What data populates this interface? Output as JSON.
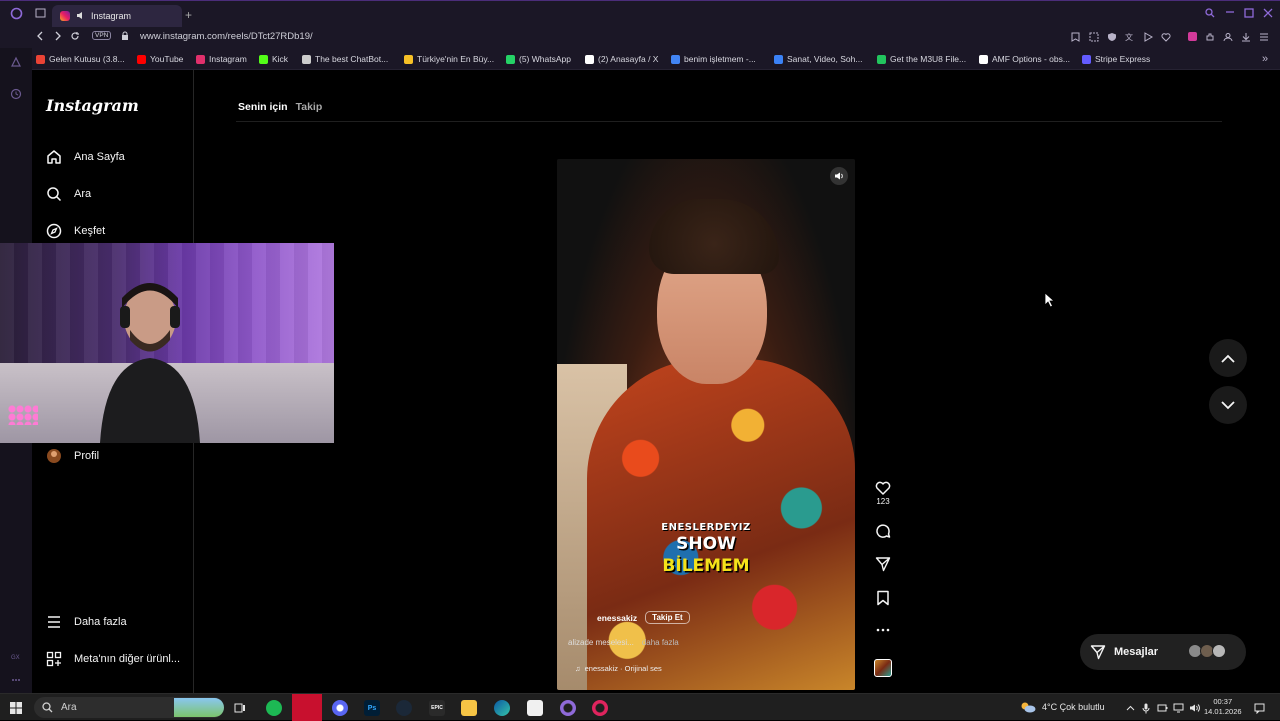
{
  "browser": {
    "tab_title": "Instagram",
    "url": "www.instagram.com/reels/DTct27RDb19/",
    "vpn_label": "VPN",
    "bookmarks": [
      {
        "label": "Gelen Kutusu (3.8...",
        "color": "#ea4335"
      },
      {
        "label": "YouTube",
        "color": "#ff0000"
      },
      {
        "label": "Instagram",
        "color": "#e1306c"
      },
      {
        "label": "Kick",
        "color": "#53fc18"
      },
      {
        "label": "The best ChatBot...",
        "color": "#cccccc"
      },
      {
        "label": "Türkiye'nin En Büy...",
        "color": "#f6c026"
      },
      {
        "label": "(5) WhatsApp",
        "color": "#25d366"
      },
      {
        "label": "(2) Anasayfa / X",
        "color": "#ffffff"
      },
      {
        "label": "benim işletmem -...",
        "color": "#4285f4"
      },
      {
        "label": "Sanat, Video, Soh...",
        "color": "#3b82f6"
      },
      {
        "label": "Get the M3U8 File...",
        "color": "#22c55e"
      },
      {
        "label": "AMF Options - obs...",
        "color": "#ffffff"
      },
      {
        "label": "Stripe Express",
        "color": "#635bff"
      }
    ]
  },
  "sidebar": {
    "logo": "Instagram",
    "items": [
      {
        "label": "Ana Sayfa",
        "icon": "home-icon"
      },
      {
        "label": "Ara",
        "icon": "search-icon"
      },
      {
        "label": "Keşfet",
        "icon": "explore-icon"
      },
      {
        "label": "Profil",
        "icon": "avatar"
      },
      {
        "label": "Daha fazla",
        "icon": "menu-icon"
      },
      {
        "label": "Meta'nın diğer ürünl...",
        "icon": "meta-grid-icon"
      }
    ]
  },
  "feed": {
    "tab_for_you": "Senin için",
    "tab_following": "Takip"
  },
  "reel": {
    "caption_line1": "ENESLERDEYIZ",
    "caption_line2": "SHOW",
    "caption_line3": "BİLEMEM",
    "username": "enessakiz",
    "follow_label": "Takip Et",
    "description": "alizade meselesi...",
    "more_label": "daha fazla",
    "audio": "enessakiz · Orijinal ses",
    "like_count": "123"
  },
  "messages": {
    "label": "Mesajlar"
  },
  "taskbar": {
    "search_placeholder": "Ara",
    "weather": "4°C  Çok bulutlu",
    "time": "00:37",
    "date": "14.01.2026"
  },
  "colors": {
    "background": "#000000",
    "browser_chrome": "#1b1726",
    "accent_purple": "#6b3aa8",
    "caption_yellow": "#f4e21a"
  }
}
